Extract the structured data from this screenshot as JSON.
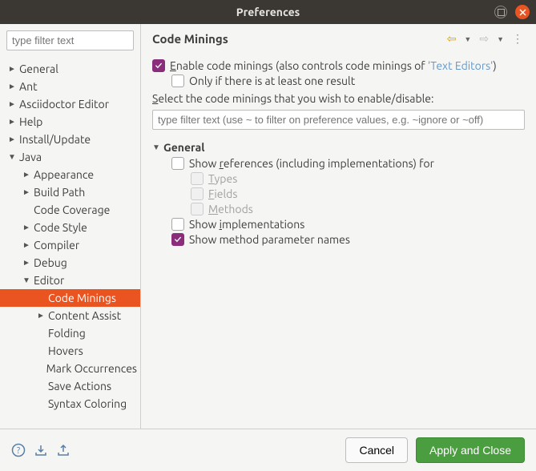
{
  "window": {
    "title": "Preferences"
  },
  "sidebar": {
    "filter_placeholder": "type filter text",
    "items": [
      {
        "label": "General",
        "depth": 0,
        "arrow": "►"
      },
      {
        "label": "Ant",
        "depth": 0,
        "arrow": "►"
      },
      {
        "label": "Asciidoctor Editor",
        "depth": 0,
        "arrow": "►"
      },
      {
        "label": "Help",
        "depth": 0,
        "arrow": "►"
      },
      {
        "label": "Install/Update",
        "depth": 0,
        "arrow": "►"
      },
      {
        "label": "Java",
        "depth": 0,
        "arrow": "▼"
      },
      {
        "label": "Appearance",
        "depth": 1,
        "arrow": "►"
      },
      {
        "label": "Build Path",
        "depth": 1,
        "arrow": "►"
      },
      {
        "label": "Code Coverage",
        "depth": 1,
        "arrow": ""
      },
      {
        "label": "Code Style",
        "depth": 1,
        "arrow": "►"
      },
      {
        "label": "Compiler",
        "depth": 1,
        "arrow": "►"
      },
      {
        "label": "Debug",
        "depth": 1,
        "arrow": "►"
      },
      {
        "label": "Editor",
        "depth": 1,
        "arrow": "▼"
      },
      {
        "label": "Code Minings",
        "depth": 2,
        "arrow": "",
        "selected": true
      },
      {
        "label": "Content Assist",
        "depth": 2,
        "arrow": "►"
      },
      {
        "label": "Folding",
        "depth": 2,
        "arrow": ""
      },
      {
        "label": "Hovers",
        "depth": 2,
        "arrow": ""
      },
      {
        "label": "Mark Occurrences",
        "depth": 2,
        "arrow": ""
      },
      {
        "label": "Save Actions",
        "depth": 2,
        "arrow": ""
      },
      {
        "label": "Syntax Coloring",
        "depth": 2,
        "arrow": ""
      }
    ]
  },
  "main": {
    "title": "Code Minings",
    "enable_prefix": "Enable code minings (also controls code minings of ",
    "enable_link": "'Text Editors'",
    "enable_suffix": ")",
    "only_if": "Only if there is at least one result",
    "select_text": "Select the code minings that you wish to enable/disable:",
    "filter_placeholder": "type filter text (use ~ to filter on preference values, e.g. ~ignore or ~off)",
    "group": {
      "title": "General",
      "show_references": "Show references (including implementations) for",
      "types": "Types",
      "fields": "Fields",
      "methods": "Methods",
      "show_impl": "Show implementations",
      "show_params": "Show method parameter names"
    }
  },
  "footer": {
    "cancel": "Cancel",
    "apply": "Apply and Close"
  }
}
